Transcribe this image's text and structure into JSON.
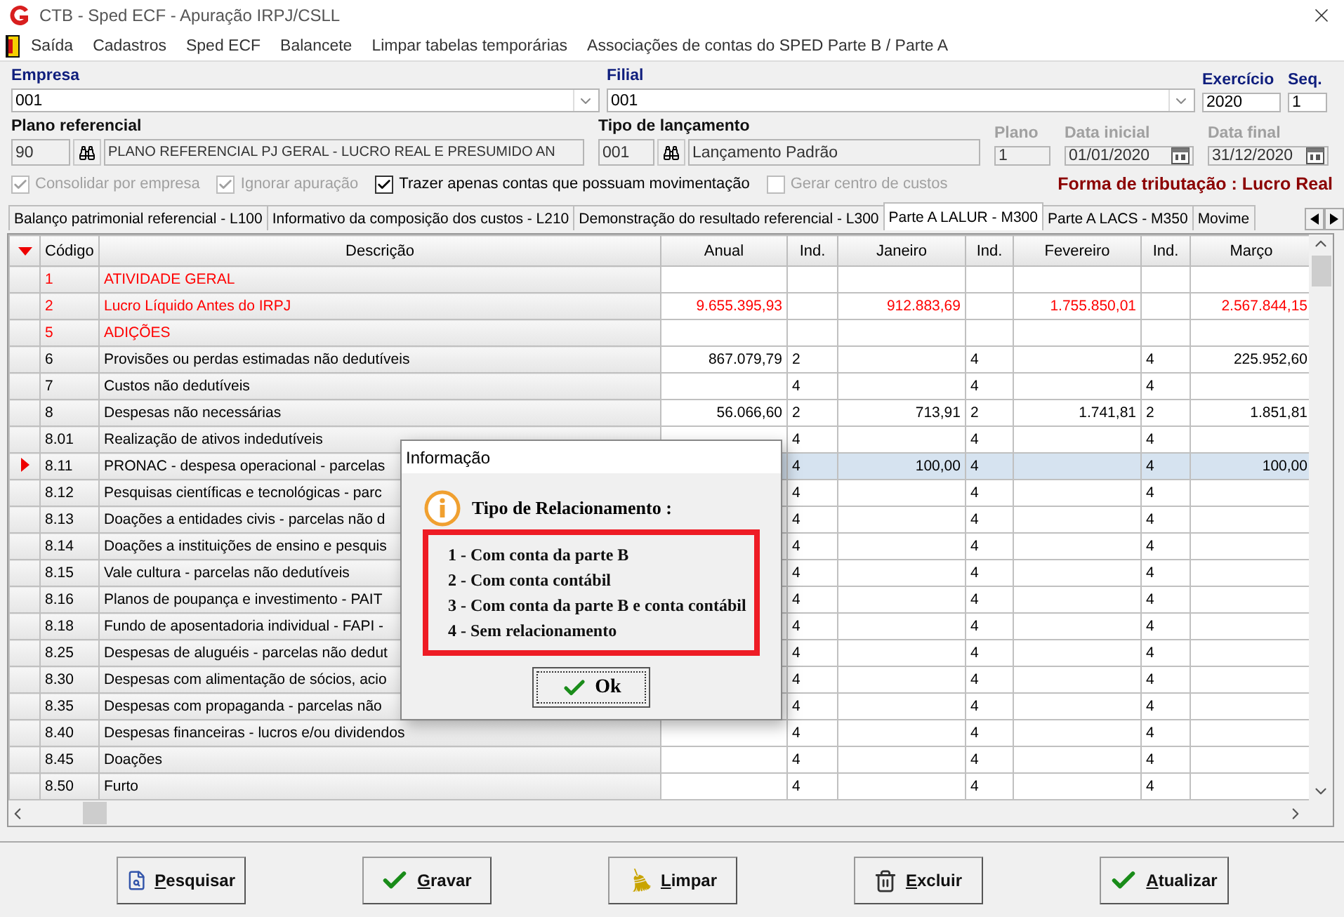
{
  "window": {
    "title": "CTB - Sped ECF - Apuração IRPJ/CSLL"
  },
  "menu": [
    {
      "label": "Saída",
      "kind": "exit"
    },
    {
      "label": "Cadastros",
      "kind": "plain"
    },
    {
      "label": "Sped ECF",
      "kind": "plain"
    },
    {
      "label": "Balancete",
      "kind": "plain"
    },
    {
      "label": "Limpar tabelas temporárias",
      "kind": "plain"
    },
    {
      "label": "Associações de contas do SPED Parte B / Parte A",
      "kind": "plain"
    }
  ],
  "form": {
    "empresa": {
      "label": "Empresa",
      "value": "001",
      "required": true
    },
    "filial": {
      "label": "Filial",
      "value": "001",
      "required": true
    },
    "exercicio": {
      "label": "Exercício",
      "value": "2020",
      "required": true
    },
    "seq": {
      "label": "Seq.",
      "value": "1",
      "required": true
    },
    "plano_referencial": {
      "label": "Plano referencial",
      "code": "90",
      "value": "PLANO REFERENCIAL PJ GERAL - LUCRO REAL E PRESUMIDO AN",
      "readonly": true
    },
    "tipo_lancamento": {
      "label": "Tipo de lançamento",
      "code": "001",
      "value": "Lançamento Padrão",
      "readonly": true
    },
    "plano": {
      "label": "Plano",
      "value": "1",
      "disabled": true
    },
    "data_inicial": {
      "label": "Data inicial",
      "value": "01/01/2020",
      "disabled": true
    },
    "data_final": {
      "label": "Data final",
      "value": "31/12/2020",
      "disabled": true
    }
  },
  "options": [
    {
      "label": "Consolidar por empresa",
      "checked": true,
      "disabled": true
    },
    {
      "label": "Ignorar apuração",
      "checked": true,
      "disabled": true
    },
    {
      "label": "Trazer apenas contas que possuam movimentação",
      "checked": true,
      "disabled": false
    },
    {
      "label": "Gerar centro de custos",
      "checked": false,
      "disabled": true
    }
  ],
  "tax_regime": "Forma de tributação : Lucro Real",
  "tabs": [
    {
      "label": "Balanço patrimonial referencial - L100",
      "selected": false
    },
    {
      "label": "Informativo da composição dos custos - L210",
      "selected": false
    },
    {
      "label": "Demonstração do resultado referencial - L300",
      "selected": false
    },
    {
      "label": "Parte A LALUR - M300",
      "selected": true
    },
    {
      "label": "Parte A LACS - M350",
      "selected": false
    },
    {
      "label": "Movime",
      "selected": false
    }
  ],
  "table": {
    "columns": [
      "Código",
      "Descrição",
      "Anual",
      "Ind.",
      "Janeiro",
      "Ind.",
      "Fevereiro",
      "Ind.",
      "Março"
    ],
    "rows": [
      {
        "kind": "group",
        "selected": false,
        "cells": [
          "1",
          "ATIVIDADE GERAL",
          "",
          "",
          "",
          "",
          "",
          "",
          ""
        ]
      },
      {
        "kind": "group",
        "selected": false,
        "cells": [
          "2",
          "Lucro Líquido Antes do IRPJ",
          "9.655.395,93",
          "",
          "912.883,69",
          "",
          "1.755.850,01",
          "",
          "2.567.844,15"
        ]
      },
      {
        "kind": "group",
        "selected": false,
        "cells": [
          "5",
          "ADIÇÕES",
          "",
          "",
          "",
          "",
          "",
          "",
          ""
        ]
      },
      {
        "kind": "account",
        "selected": false,
        "cells": [
          "6",
          "Provisões ou perdas estimadas não dedutíveis",
          "867.079,79",
          "2",
          "",
          "4",
          "",
          "4",
          "225.952,60"
        ]
      },
      {
        "kind": "account",
        "selected": false,
        "cells": [
          "7",
          "Custos não dedutíveis",
          "",
          "4",
          "",
          "4",
          "",
          "4",
          ""
        ]
      },
      {
        "kind": "account",
        "selected": false,
        "cells": [
          "8",
          "Despesas não necessárias",
          "56.066,60",
          "2",
          "713,91",
          "2",
          "1.741,81",
          "2",
          "1.851,81"
        ]
      },
      {
        "kind": "account",
        "selected": false,
        "cells": [
          "8.01",
          "Realização de ativos indedutíveis",
          "",
          "4",
          "",
          "4",
          "",
          "4",
          ""
        ]
      },
      {
        "kind": "account",
        "selected": true,
        "cells": [
          "8.11",
          "PRONAC - despesa operacional - parcelas",
          "",
          "4",
          "100,00",
          "4",
          "",
          "4",
          "100,00"
        ]
      },
      {
        "kind": "account",
        "selected": false,
        "cells": [
          "8.12",
          "Pesquisas científicas e tecnológicas - parc",
          "",
          "4",
          "",
          "4",
          "",
          "4",
          ""
        ]
      },
      {
        "kind": "account",
        "selected": false,
        "cells": [
          "8.13",
          "Doações a entidades civis - parcelas não d",
          "",
          "4",
          "",
          "4",
          "",
          "4",
          ""
        ]
      },
      {
        "kind": "account",
        "selected": false,
        "cells": [
          "8.14",
          "Doações a instituições de ensino e pesquis",
          "",
          "4",
          "",
          "4",
          "",
          "4",
          ""
        ]
      },
      {
        "kind": "account",
        "selected": false,
        "cells": [
          "8.15",
          "Vale cultura - parcelas não dedutíveis",
          "",
          "4",
          "",
          "4",
          "",
          "4",
          ""
        ]
      },
      {
        "kind": "account",
        "selected": false,
        "cells": [
          "8.16",
          "Planos de poupança e investimento - PAIT",
          "",
          "4",
          "",
          "4",
          "",
          "4",
          ""
        ]
      },
      {
        "kind": "account",
        "selected": false,
        "cells": [
          "8.18",
          "Fundo de aposentadoria individual - FAPI -",
          "",
          "4",
          "",
          "4",
          "",
          "4",
          ""
        ]
      },
      {
        "kind": "account",
        "selected": false,
        "cells": [
          "8.25",
          "Despesas de aluguéis - parcelas não dedut",
          "",
          "4",
          "",
          "4",
          "",
          "4",
          ""
        ]
      },
      {
        "kind": "account",
        "selected": false,
        "cells": [
          "8.30",
          "Despesas com alimentação de sócios, acio",
          "",
          "4",
          "",
          "4",
          "",
          "4",
          ""
        ]
      },
      {
        "kind": "account",
        "selected": false,
        "cells": [
          "8.35",
          "Despesas com propaganda - parcelas não",
          "",
          "4",
          "",
          "4",
          "",
          "4",
          ""
        ]
      },
      {
        "kind": "account",
        "selected": false,
        "cells": [
          "8.40",
          "Despesas financeiras - lucros e/ou dividendos",
          "",
          "4",
          "",
          "4",
          "",
          "4",
          ""
        ]
      },
      {
        "kind": "account",
        "selected": false,
        "cells": [
          "8.45",
          "Doações",
          "",
          "4",
          "",
          "4",
          "",
          "4",
          ""
        ]
      },
      {
        "kind": "account",
        "selected": false,
        "cells": [
          "8.50",
          "Furto",
          "",
          "4",
          "",
          "4",
          "",
          "4",
          ""
        ]
      }
    ]
  },
  "dialog": {
    "title": "Informação",
    "heading": "Tipo de Relacionamento :",
    "items": [
      "1 - Com conta da parte B",
      "2 - Com conta contábil",
      "3 - Com conta da parte B e conta contábil",
      "4 - Sem relacionamento"
    ],
    "button": "Ok"
  },
  "buttons": [
    {
      "label": "Pesquisar",
      "kind": "search"
    },
    {
      "label": "Gravar",
      "kind": "save"
    },
    {
      "label": "Limpar",
      "kind": "clear"
    },
    {
      "label": "Excluir",
      "kind": "delete"
    },
    {
      "label": "Atualizar",
      "kind": "refresh"
    }
  ]
}
